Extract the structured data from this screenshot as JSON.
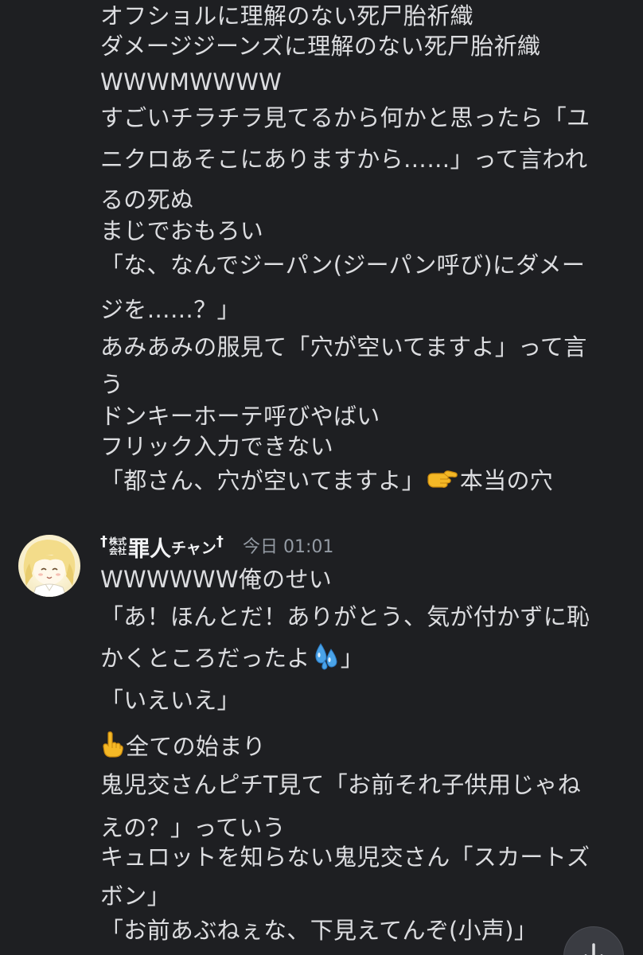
{
  "messages_prev": {
    "lines": [
      "オフショルに理解のない死尸胎祈織",
      "ダメージジーンズに理解のない死尸胎祈織",
      "WWWMWWWW",
      "すごいチラチラ見てるから何かと思ったら「ユ",
      "ニクロあそこにありますから……」って言われ",
      "るの死ぬ",
      "まじでおもろい",
      "「な、なんでジーパン(ジーパン呼び)にダメー",
      "ジを……？」",
      "あみあみの服見て「穴が空いてますよ」って言",
      "う",
      "ドンキーホーテ呼びやばい",
      "フリック入力できない"
    ],
    "last_line_before": "「都さん、穴が空いてますよ」",
    "last_line_emoji": "backhand-index-pointing-right-emoji",
    "last_line_after": "本当の穴"
  },
  "message": {
    "author": {
      "prefix": "†",
      "kabu_top": "株式",
      "kabu_bottom": "会社",
      "name_main": "罪人",
      "name_small": "チャン",
      "suffix": "†"
    },
    "timestamp": "今日 01:01",
    "line1": "WWWWWW俺のせい",
    "line2": "「あ！ほんとだ！ありがとう、気が付かずに恥",
    "line3_before": "かくところだったよ",
    "line3_emoji": "sweat-droplets-emoji",
    "line3_after": "」",
    "line4": "「いえいえ」",
    "line5_emoji": "index-pointing-up-emoji",
    "line5_after": "全ての始まり",
    "line6": "鬼児交さんピチT見て「お前それ子供用じゃね",
    "line7": "えの？」っていう",
    "line8": "キュロットを知らない鬼児交さん「スカートズ",
    "line9": "ボン」",
    "line10": "「お前あぶねぇな、下見えてんぞ(小声)」"
  },
  "scroll_button_icon": "arrow-down-icon",
  "colors": {
    "background": "#1e1f22",
    "text": "#dcdde0",
    "timestamp": "#949ba4",
    "username": "#f2f3f5"
  }
}
